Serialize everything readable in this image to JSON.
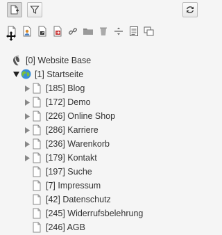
{
  "toolbar_top": {
    "new_page_tooltip": "new-page",
    "filter_tooltip": "filter",
    "refresh_tooltip": "refresh"
  },
  "tree": {
    "root": {
      "label": "[0] Website Base",
      "icon": "typo3-logo-icon"
    },
    "site": {
      "label": "[1] Startseite",
      "icon": "globe-icon"
    },
    "pages": [
      {
        "label": "[185] Blog",
        "has_children": true
      },
      {
        "label": "[172] Demo",
        "has_children": true
      },
      {
        "label": "[226] Online Shop",
        "has_children": true
      },
      {
        "label": "[286] Karriere",
        "has_children": true
      },
      {
        "label": "[236] Warenkorb",
        "has_children": true
      },
      {
        "label": "[179] Kontakt",
        "has_children": true
      },
      {
        "label": "[197] Suche",
        "has_children": false
      },
      {
        "label": "[7] Impressum",
        "has_children": false
      },
      {
        "label": "[42] Datenschutz",
        "has_children": false
      },
      {
        "label": "[245] Widerrufsbelehrung",
        "has_children": false
      },
      {
        "label": "[246] AGB",
        "has_children": false
      }
    ]
  },
  "colors": {
    "background": "#f5f5f5",
    "logo_orange": "#ff8700",
    "red_doc": "#c83c3c"
  }
}
